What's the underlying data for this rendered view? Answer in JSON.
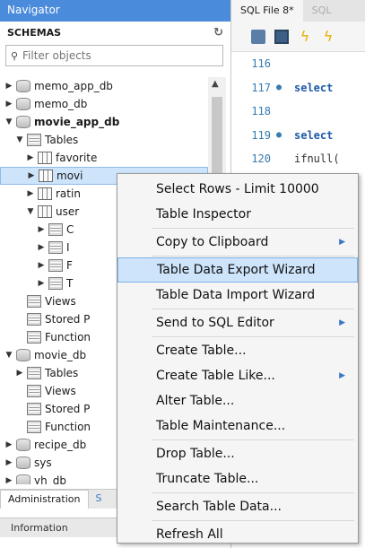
{
  "navigator": {
    "title": "Navigator",
    "schemas_label": "SCHEMAS",
    "filter_placeholder": "Filter objects",
    "tree": [
      {
        "label": "memo_app_db",
        "indent": 0,
        "arrow": "▶",
        "icon": "db"
      },
      {
        "label": "memo_db",
        "indent": 0,
        "arrow": "▶",
        "icon": "db"
      },
      {
        "label": "movie_app_db",
        "indent": 0,
        "arrow": "▼",
        "icon": "db",
        "bold": true
      },
      {
        "label": "Tables",
        "indent": 1,
        "arrow": "▼",
        "icon": "folder"
      },
      {
        "label": "favorite",
        "indent": 2,
        "arrow": "▶",
        "icon": "table"
      },
      {
        "label": "movi",
        "indent": 2,
        "arrow": "▶",
        "icon": "table",
        "selected": true
      },
      {
        "label": "ratin",
        "indent": 2,
        "arrow": "▶",
        "icon": "table"
      },
      {
        "label": "user",
        "indent": 2,
        "arrow": "▼",
        "icon": "table"
      },
      {
        "label": "C",
        "indent": 3,
        "arrow": "▶",
        "icon": "folder"
      },
      {
        "label": "I",
        "indent": 3,
        "arrow": "▶",
        "icon": "folder"
      },
      {
        "label": "F",
        "indent": 3,
        "arrow": "▶",
        "icon": "folder"
      },
      {
        "label": "T",
        "indent": 3,
        "arrow": "▶",
        "icon": "folder"
      },
      {
        "label": "Views",
        "indent": 1,
        "arrow": "",
        "icon": "folder"
      },
      {
        "label": "Stored P",
        "indent": 1,
        "arrow": "",
        "icon": "folder"
      },
      {
        "label": "Function",
        "indent": 1,
        "arrow": "",
        "icon": "folder"
      },
      {
        "label": "movie_db",
        "indent": 0,
        "arrow": "▼",
        "icon": "db"
      },
      {
        "label": "Tables",
        "indent": 1,
        "arrow": "▶",
        "icon": "folder"
      },
      {
        "label": "Views",
        "indent": 1,
        "arrow": "",
        "icon": "folder"
      },
      {
        "label": "Stored P",
        "indent": 1,
        "arrow": "",
        "icon": "folder"
      },
      {
        "label": "Function",
        "indent": 1,
        "arrow": "",
        "icon": "folder"
      },
      {
        "label": "recipe_db",
        "indent": 0,
        "arrow": "▶",
        "icon": "db"
      },
      {
        "label": "sys",
        "indent": 0,
        "arrow": "▶",
        "icon": "db"
      },
      {
        "label": "yh_db",
        "indent": 0,
        "arrow": "▶",
        "icon": "db"
      }
    ],
    "bottom_tabs": [
      "Administration",
      "S"
    ],
    "info_label": "Information"
  },
  "editor": {
    "tabs": [
      "SQL File 8*",
      "SQL"
    ],
    "lines": [
      {
        "num": "116",
        "dot": false,
        "code": ""
      },
      {
        "num": "117",
        "dot": true,
        "code": "select",
        "kw": true
      },
      {
        "num": "118",
        "dot": false,
        "code": ""
      },
      {
        "num": "119",
        "dot": true,
        "code": "select",
        "kw": true
      },
      {
        "num": "120",
        "dot": false,
        "code": "ifnull(",
        "kw": false
      }
    ]
  },
  "context_menu": {
    "groups": [
      [
        {
          "label": "Select Rows - Limit 10000"
        },
        {
          "label": "Table Inspector"
        }
      ],
      [
        {
          "label": "Copy to Clipboard",
          "submenu": true
        }
      ],
      [
        {
          "label": "Table Data Export Wizard",
          "highlighted": true
        },
        {
          "label": "Table Data Import Wizard"
        }
      ],
      [
        {
          "label": "Send to SQL Editor",
          "submenu": true
        }
      ],
      [
        {
          "label": "Create Table..."
        },
        {
          "label": "Create Table Like...",
          "submenu": true
        },
        {
          "label": "Alter Table..."
        },
        {
          "label": "Table Maintenance..."
        }
      ],
      [
        {
          "label": "Drop Table..."
        },
        {
          "label": "Truncate Table..."
        }
      ],
      [
        {
          "label": "Search Table Data..."
        }
      ],
      [
        {
          "label": "Refresh All"
        }
      ]
    ]
  }
}
